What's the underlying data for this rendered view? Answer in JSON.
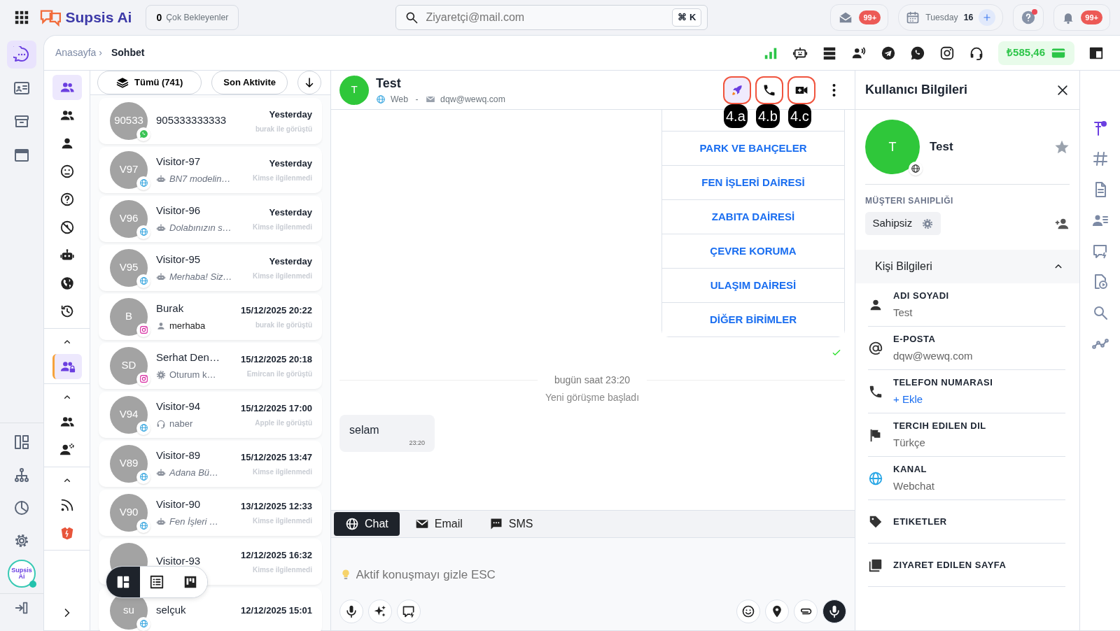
{
  "top_bar": {
    "logo": "Supsis Ai",
    "waiting": {
      "count": "0",
      "label": "Çok Bekleyenler"
    },
    "search": {
      "placeholder": "Ziyaretçi@mail.com",
      "shortcut": "⌘ K"
    },
    "mail_badge": "99+",
    "calendar": {
      "day": "Tuesday",
      "date": "16"
    },
    "help_alert": true,
    "notifications_badge": "99+"
  },
  "rail": {
    "top": [
      {
        "kind": "chat",
        "selected": true
      },
      {
        "kind": "idcard",
        "selected": false
      },
      {
        "kind": "archive",
        "selected": false
      },
      {
        "kind": "window",
        "selected": false
      }
    ],
    "bottom": [
      {
        "kind": "dashboard",
        "selected": false
      },
      {
        "kind": "hierarchy",
        "selected": false
      },
      {
        "kind": "pie",
        "selected": false
      },
      {
        "kind": "gear",
        "selected": false
      }
    ],
    "avatar": {
      "text": "Supsis Ai",
      "online": true
    }
  },
  "breadcrumb": {
    "items": [
      "Anasayfa",
      "Sohbet"
    ],
    "separator": "›"
  },
  "toolbar": {
    "icons": [
      {
        "kind": "signal"
      },
      {
        "kind": "robotchat"
      },
      {
        "kind": "server"
      },
      {
        "kind": "speaker"
      },
      {
        "kind": "telegram"
      },
      {
        "kind": "whatsapp"
      },
      {
        "kind": "instagram"
      },
      {
        "kind": "headset"
      }
    ],
    "balance": "₺585,46"
  },
  "subnav": [
    {
      "items": [
        {
          "kind": "users",
          "selected": true
        },
        {
          "kind": "users",
          "selected": false
        },
        {
          "kind": "user",
          "selected": false
        },
        {
          "kind": "face",
          "selected": false
        },
        {
          "kind": "question",
          "selected": false
        },
        {
          "kind": "nosign",
          "selected": false
        },
        {
          "kind": "robot",
          "selected": false
        },
        {
          "kind": "globefill",
          "selected": false
        },
        {
          "kind": "history",
          "selected": false
        }
      ]
    },
    {
      "collapsible": true,
      "items": [
        {
          "kind": "userslock",
          "selected": true
        }
      ]
    },
    {
      "collapsible": true,
      "items": [
        {
          "kind": "users",
          "selected": false
        },
        {
          "kind": "usergear",
          "selected": false
        }
      ]
    },
    {
      "collapsible": true,
      "items": [
        {
          "kind": "rss",
          "selected": false
        },
        {
          "kind": "brand",
          "selected": false
        }
      ]
    }
  ],
  "filters": {
    "all": "Tümü (741)",
    "sort": "Son Aktivite"
  },
  "conversations": [
    {
      "name": "905333333333",
      "avatar": "90533",
      "badge": {
        "kind": "whatsapp"
      },
      "time": "Yesterday",
      "note": "burak ile görüştü"
    },
    {
      "name": "Visitor-97",
      "avatar": "V97",
      "badge": {
        "kind": "web"
      },
      "preview": {
        "kind": "bot",
        "text": "BN7 modelin…"
      },
      "time": "Yesterday",
      "note": "Kimse ilgilenmedi"
    },
    {
      "name": "Visitor-96",
      "avatar": "V96",
      "badge": {
        "kind": "web"
      },
      "preview": {
        "kind": "bot",
        "text": "Dolabınızın s…"
      },
      "time": "Yesterday",
      "note": "Kimse ilgilenmedi"
    },
    {
      "name": "Visitor-95",
      "avatar": "V95",
      "badge": {
        "kind": "web"
      },
      "preview": {
        "kind": "bot",
        "text": "Merhaba! Siz…"
      },
      "time": "Yesterday",
      "note": "Kimse ilgilenmedi"
    },
    {
      "name": "Burak",
      "avatar": "B",
      "badge": {
        "kind": "instagram"
      },
      "preview": {
        "kind": "user",
        "text": "merhaba"
      },
      "time": "15/12/2025 20:22",
      "note": "burak ile görüştü"
    },
    {
      "name": "Serhat Den…",
      "avatar": "SD",
      "badge": {
        "kind": "instagram"
      },
      "preview": {
        "kind": "system",
        "text": "Oturum k…"
      },
      "time": "15/12/2025 20:18",
      "note": "Emircan ile görüştü"
    },
    {
      "name": "Visitor-94",
      "avatar": "V94",
      "badge": {
        "kind": "web"
      },
      "preview": {
        "kind": "agent",
        "text": "naber"
      },
      "time": "15/12/2025 17:00",
      "note": "Apple ile görüştü"
    },
    {
      "name": "Visitor-89",
      "avatar": "V89",
      "badge": {
        "kind": "web"
      },
      "preview": {
        "kind": "bot",
        "text": "Adana Bü…"
      },
      "time": "15/12/2025 13:47",
      "note": "Kimse ilgilenmedi"
    },
    {
      "name": "Visitor-90",
      "avatar": "V90",
      "badge": {
        "kind": "web"
      },
      "preview": {
        "kind": "bot",
        "text": "Fen İşleri …"
      },
      "time": "13/12/2025 12:33",
      "note": "Kimse ilgilenmedi"
    },
    {
      "name": "Visitor-93",
      "time": "12/12/2025 16:32",
      "note": "Kimse ilgilenmedi"
    },
    {
      "name": "selçuk",
      "avatar": "su",
      "badge": {
        "kind": "web"
      },
      "time": "12/12/2025 15:01"
    }
  ],
  "view_toggle": [
    {
      "kind": "board",
      "selected": true
    },
    {
      "kind": "list",
      "selected": false
    },
    {
      "kind": "kanban",
      "selected": false
    }
  ],
  "chat": {
    "name": "Test",
    "avatar": "T",
    "source": "Web",
    "separator": "-",
    "email": "dqw@wewq.com",
    "actions": [
      {
        "kind": "rocket",
        "callout": "4.a"
      },
      {
        "kind": "phone",
        "callout": "4.b"
      },
      {
        "kind": "video",
        "callout": "4.c"
      }
    ],
    "quick_replies": [
      "PARK VE BAHÇELER",
      "FEN İŞLERİ DAİRESİ",
      "ZABITA DAİRESİ",
      "ÇEVRE KORUMA",
      "ULAŞIM DAİRESİ",
      "DİĞER BİRİMLER"
    ],
    "delivered": true,
    "divider": "bugün saat 23:20",
    "system_note": "Yeni görüşme başladı",
    "messages": [
      {
        "text": "selam",
        "time": "23:20"
      }
    ],
    "tabs": [
      {
        "kind": "chat",
        "label": "Chat",
        "selected": true
      },
      {
        "kind": "email",
        "label": "Email",
        "selected": false
      },
      {
        "kind": "sms",
        "label": "SMS",
        "selected": false
      }
    ],
    "composer": {
      "placeholder": "Aktif konuşmayı gizle ESC"
    },
    "composer_left": [
      {
        "kind": "mic"
      },
      {
        "kind": "sparkles"
      },
      {
        "kind": "chatbolt"
      }
    ],
    "composer_right": [
      {
        "kind": "smile"
      },
      {
        "kind": "pin"
      },
      {
        "kind": "clip"
      },
      {
        "kind": "micfill"
      }
    ]
  },
  "user_info": {
    "title": "Kullanıcı Bilgileri",
    "avatar": "T",
    "name": "Test",
    "starred": false,
    "ownership_label": "MÜŞTERI SAHIPLIĞI",
    "owner": "Sahipsiz",
    "section": {
      "title": "Kişi Bilgileri",
      "expanded": true
    },
    "fields": [
      {
        "kind": "user",
        "label": "ADI SOYADI",
        "value": "Test"
      },
      {
        "kind": "at",
        "label": "E-POSTA",
        "value": "dqw@wewq.com"
      },
      {
        "kind": "phone",
        "label": "TELEFON NUMARASI",
        "link": "+ Ekle"
      },
      {
        "kind": "flag",
        "label": "TERCIH EDILEN DIL",
        "value": "Türkçe"
      },
      {
        "kind": "globe",
        "label": "KANAL",
        "value": "Webchat"
      },
      {
        "kind": "tag",
        "label": "ETIKETLER"
      },
      {
        "kind": "pages",
        "label": "ZIYARET EDILEN SAYFA"
      }
    ]
  },
  "side_tools": [
    {
      "kind": "pinuser",
      "selected": true
    },
    {
      "kind": "hash",
      "selected": false
    },
    {
      "kind": "doc",
      "selected": false
    },
    {
      "kind": "userlist",
      "selected": false
    },
    {
      "kind": "chatbolt",
      "selected": false
    },
    {
      "kind": "fileplay",
      "selected": false
    },
    {
      "kind": "search",
      "selected": false
    },
    {
      "kind": "graph",
      "selected": false
    }
  ]
}
